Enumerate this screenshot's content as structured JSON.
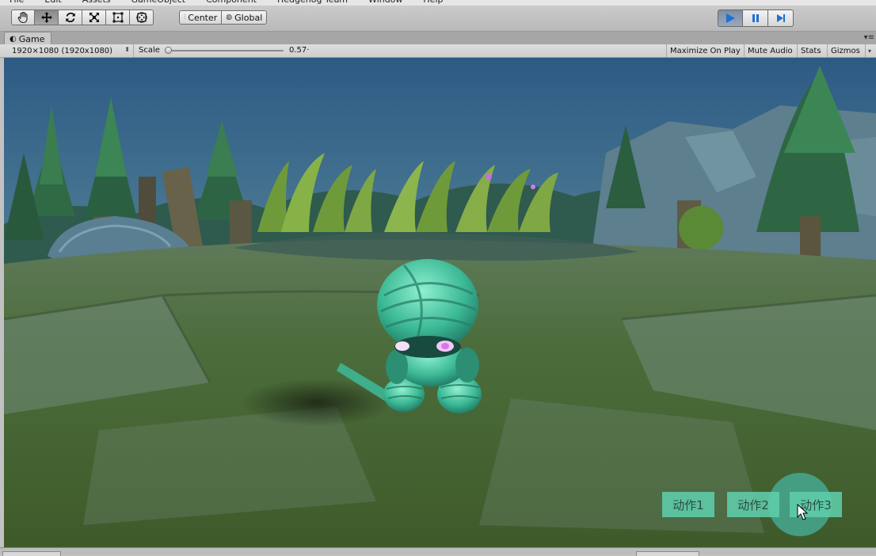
{
  "menubar": {
    "items": [
      "File",
      "Edit",
      "Assets",
      "GameObject",
      "Component",
      "Hedgehog Team",
      "Window",
      "Help"
    ]
  },
  "toolbar": {
    "tools": [
      {
        "name": "hand-tool",
        "icon": "hand-icon"
      },
      {
        "name": "move-tool",
        "icon": "move-icon"
      },
      {
        "name": "rotate-tool",
        "icon": "rotate-icon"
      },
      {
        "name": "scale-tool",
        "icon": "scale-icon"
      },
      {
        "name": "rect-tool",
        "icon": "rect-icon"
      },
      {
        "name": "transform-tool",
        "icon": "transform-icon"
      }
    ],
    "active_tool": "move-tool",
    "pivot_label": "Center",
    "space_label": "Global",
    "play_controls": [
      "play-icon",
      "pause-icon",
      "step-icon"
    ],
    "play_accent": "#1f6fd6"
  },
  "tab": {
    "label": "Game",
    "icon": "game-icon"
  },
  "gamebar": {
    "resolution": "1920×1080 (1920x1080)",
    "scale_label": "Scale",
    "scale_value": "0.57·",
    "maximize_label": "Maximize On Play",
    "mute_label": "Mute Audio",
    "stats_label": "Stats",
    "gizmos_label": "Gizmos"
  },
  "game_ui": {
    "buttons": [
      "动作1",
      "动作2",
      "动作3"
    ],
    "button_color": "#5fcdaa"
  }
}
